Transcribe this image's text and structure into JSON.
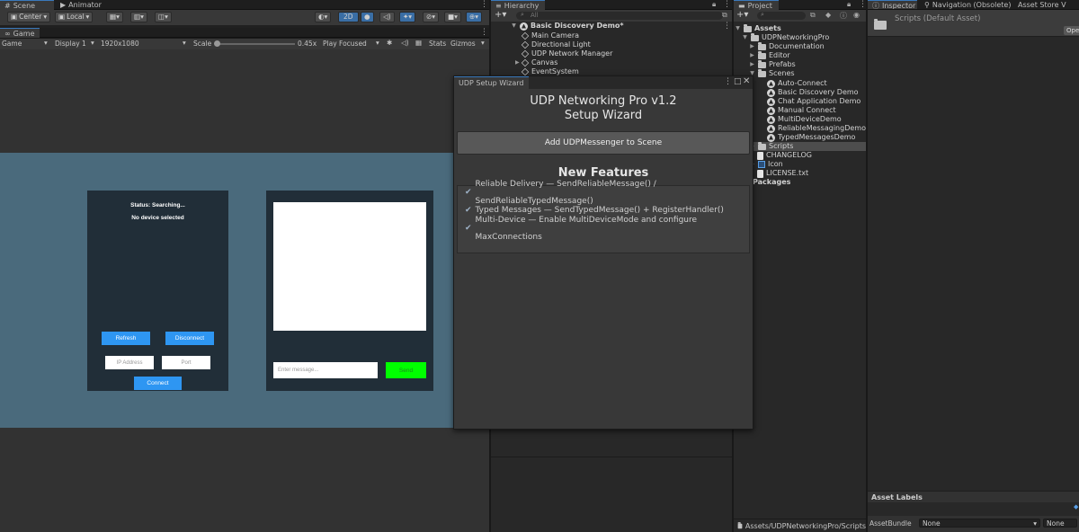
{
  "scene_tabs": {
    "scene": "Scene",
    "animator": "Animator"
  },
  "scene_toolbar": {
    "center": "Center",
    "local": "Local",
    "two_d": "2D"
  },
  "game_tab": "Game",
  "game_toolbar": {
    "game": "Game",
    "display": "Display 1",
    "resolution": "1920x1080",
    "scale_label": "Scale",
    "scale_value": "0.45x",
    "play_focused": "Play Focused",
    "stats": "Stats",
    "gizmos": "Gizmos"
  },
  "game_view": {
    "status": "Status: Searching...",
    "device": "No device selected",
    "refresh": "Refresh",
    "disconnect": "Disconnect",
    "ip_placeholder": "IP Address",
    "port_placeholder": "Port",
    "connect": "Connect",
    "message_placeholder": "Enter message...",
    "send": "Send"
  },
  "hierarchy": {
    "tab": "Hierarchy",
    "search_placeholder": "All",
    "scene_name": "Basic Discovery Demo*",
    "items": [
      "Main Camera",
      "Directional Light",
      "UDP Network Manager",
      "Canvas",
      "EventSystem"
    ]
  },
  "wizard": {
    "tab": "UDP Setup Wizard",
    "title_line1": "UDP Networking Pro v1.2",
    "title_line2": "Setup Wizard",
    "add_button": "Add UDPMessenger to Scene",
    "features_title": "New Features",
    "features": [
      "Reliable Delivery — SendReliableMessage() / SendReliableTypedMessage()",
      "Typed Messages — SendTypedMessage() + RegisterHandler()",
      "Multi-Device — Enable MultiDeviceMode and configure MaxConnections"
    ]
  },
  "project": {
    "tab": "Project",
    "assets": "Assets",
    "root": "UDPNetworkingPro",
    "folders": [
      "Documentation",
      "Editor",
      "Prefabs"
    ],
    "scenes_folder": "Scenes",
    "scenes": [
      "Auto-Connect",
      "Basic Discovery Demo",
      "Chat Application Demo",
      "Manual Connect",
      "MultiDeviceDemo",
      "ReliableMessagingDemo",
      "TypedMessagesDemo"
    ],
    "scripts": "Scripts",
    "changelog": "CHANGELOG",
    "icon": "Icon",
    "license": "LICENSE.txt",
    "packages": "Packages",
    "path": "Assets/UDPNetworkingPro/Scripts"
  },
  "inspector": {
    "tabs": [
      "Inspector",
      "Navigation (Obsolete)",
      "Asset Store V"
    ],
    "title": "Scripts (Default Asset)",
    "open": "Open",
    "asset_labels": "Asset Labels",
    "asset_bundle": "AssetBundle",
    "bundle_value": "None",
    "variant_value": "None"
  },
  "colors": {
    "accent_blue": "#2e96f2",
    "send_green": "#00ff00",
    "canvas_bg": "#4a6a7c",
    "panel_bg": "#212e38"
  }
}
